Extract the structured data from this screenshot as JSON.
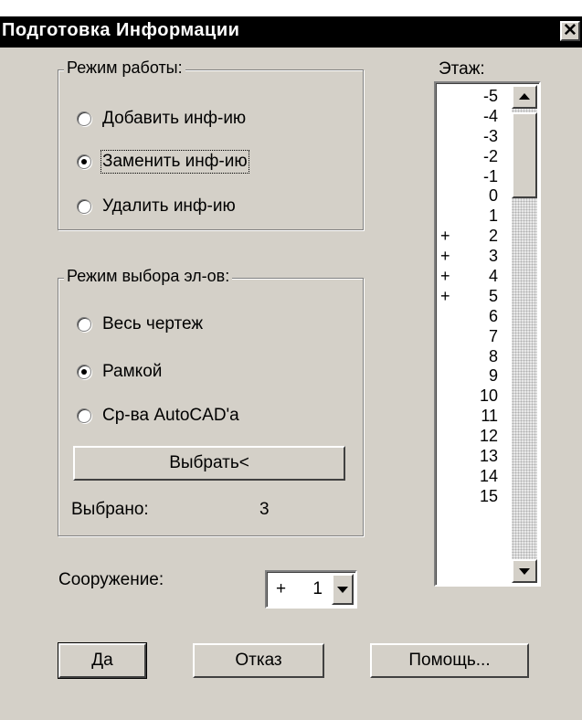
{
  "window": {
    "title": "Подготовка  Информации",
    "close_glyph": "✕"
  },
  "work_mode": {
    "label": "Режим работы:",
    "options": [
      {
        "label": "Добавить инф-ию",
        "checked": false
      },
      {
        "label": "Заменить инф-ию",
        "checked": true
      },
      {
        "label": "Удалить  инф-ию",
        "checked": false
      }
    ]
  },
  "select_mode": {
    "label": "Режим выбора эл-ов:",
    "options": [
      {
        "label": "Весь чертеж",
        "checked": false
      },
      {
        "label": "Рамкой",
        "checked": true
      },
      {
        "label": "Ср-ва AutoCAD'a",
        "checked": false
      }
    ],
    "select_button": "Выбрать<",
    "selected_label": "Выбрано:",
    "selected_count": "3"
  },
  "floors": {
    "label": "Этаж:",
    "items": [
      {
        "mark": "",
        "value": "-5"
      },
      {
        "mark": "",
        "value": "-4"
      },
      {
        "mark": "",
        "value": "-3"
      },
      {
        "mark": "",
        "value": "-2"
      },
      {
        "mark": "",
        "value": "-1"
      },
      {
        "mark": "",
        "value": "0"
      },
      {
        "mark": "",
        "value": "1"
      },
      {
        "mark": "+",
        "value": "2"
      },
      {
        "mark": "+",
        "value": "3"
      },
      {
        "mark": "+",
        "value": "4"
      },
      {
        "mark": "+",
        "value": "5"
      },
      {
        "mark": "",
        "value": "6"
      },
      {
        "mark": "",
        "value": "7"
      },
      {
        "mark": "",
        "value": "8"
      },
      {
        "mark": "",
        "value": "9"
      },
      {
        "mark": "",
        "value": "10"
      },
      {
        "mark": "",
        "value": "11"
      },
      {
        "mark": "",
        "value": "12"
      },
      {
        "mark": "",
        "value": "13"
      },
      {
        "mark": "",
        "value": "14"
      },
      {
        "mark": "",
        "value": "15"
      }
    ]
  },
  "structure": {
    "label": "Сооружение:",
    "mark": "+",
    "value": "1"
  },
  "buttons": {
    "ok": "Да",
    "cancel": "Отказ",
    "help": "Помощь..."
  }
}
